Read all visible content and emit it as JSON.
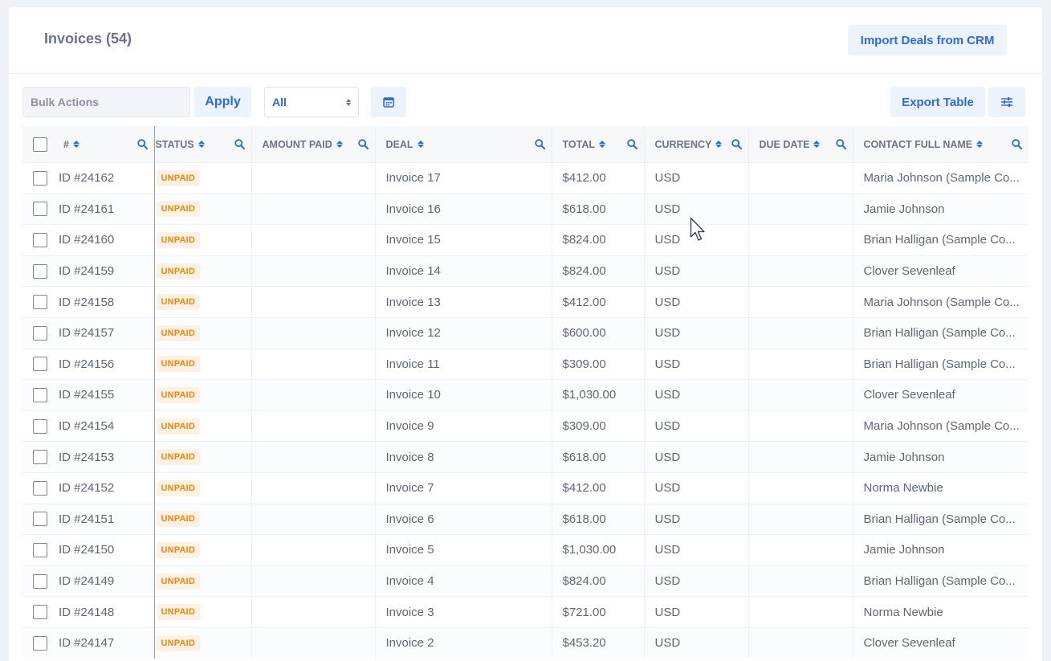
{
  "header": {
    "title": "Invoices (54)",
    "import_label": "Import Deals from CRM"
  },
  "toolbar": {
    "bulk_actions_label": "Bulk Actions",
    "apply_label": "Apply",
    "filter_value": "All",
    "export_label": "Export Table"
  },
  "table": {
    "columns": [
      "#",
      "STATUS",
      "AMOUNT PAID",
      "DEAL",
      "TOTAL",
      "CURRENCY",
      "DUE DATE",
      "CONTACT FULL NAME"
    ],
    "rows": [
      {
        "id": "ID #24162",
        "status": "UNPAID",
        "amount_paid": "",
        "deal": "Invoice 17",
        "total": "$412.00",
        "currency": "USD",
        "due_date": "",
        "contact": "Maria Johnson (Sample Co..."
      },
      {
        "id": "ID #24161",
        "status": "UNPAID",
        "amount_paid": "",
        "deal": "Invoice 16",
        "total": "$618.00",
        "currency": "USD",
        "due_date": "",
        "contact": "Jamie Johnson"
      },
      {
        "id": "ID #24160",
        "status": "UNPAID",
        "amount_paid": "",
        "deal": "Invoice 15",
        "total": "$824.00",
        "currency": "USD",
        "due_date": "",
        "contact": "Brian Halligan (Sample Co..."
      },
      {
        "id": "ID #24159",
        "status": "UNPAID",
        "amount_paid": "",
        "deal": "Invoice 14",
        "total": "$824.00",
        "currency": "USD",
        "due_date": "",
        "contact": "Clover Sevenleaf"
      },
      {
        "id": "ID #24158",
        "status": "UNPAID",
        "amount_paid": "",
        "deal": "Invoice 13",
        "total": "$412.00",
        "currency": "USD",
        "due_date": "",
        "contact": "Maria Johnson (Sample Co..."
      },
      {
        "id": "ID #24157",
        "status": "UNPAID",
        "amount_paid": "",
        "deal": "Invoice 12",
        "total": "$600.00",
        "currency": "USD",
        "due_date": "",
        "contact": "Brian Halligan (Sample Co..."
      },
      {
        "id": "ID #24156",
        "status": "UNPAID",
        "amount_paid": "",
        "deal": "Invoice 11",
        "total": "$309.00",
        "currency": "USD",
        "due_date": "",
        "contact": "Brian Halligan (Sample Co..."
      },
      {
        "id": "ID #24155",
        "status": "UNPAID",
        "amount_paid": "",
        "deal": "Invoice 10",
        "total": "$1,030.00",
        "currency": "USD",
        "due_date": "",
        "contact": "Clover Sevenleaf"
      },
      {
        "id": "ID #24154",
        "status": "UNPAID",
        "amount_paid": "",
        "deal": "Invoice 9",
        "total": "$309.00",
        "currency": "USD",
        "due_date": "",
        "contact": "Maria Johnson (Sample Co..."
      },
      {
        "id": "ID #24153",
        "status": "UNPAID",
        "amount_paid": "",
        "deal": "Invoice 8",
        "total": "$618.00",
        "currency": "USD",
        "due_date": "",
        "contact": "Jamie Johnson"
      },
      {
        "id": "ID #24152",
        "status": "UNPAID",
        "amount_paid": "",
        "deal": "Invoice 7",
        "total": "$412.00",
        "currency": "USD",
        "due_date": "",
        "contact": "Norma Newbie"
      },
      {
        "id": "ID #24151",
        "status": "UNPAID",
        "amount_paid": "",
        "deal": "Invoice 6",
        "total": "$618.00",
        "currency": "USD",
        "due_date": "",
        "contact": "Brian Halligan (Sample Co..."
      },
      {
        "id": "ID #24150",
        "status": "UNPAID",
        "amount_paid": "",
        "deal": "Invoice 5",
        "total": "$1,030.00",
        "currency": "USD",
        "due_date": "",
        "contact": "Jamie Johnson"
      },
      {
        "id": "ID #24149",
        "status": "UNPAID",
        "amount_paid": "",
        "deal": "Invoice 4",
        "total": "$824.00",
        "currency": "USD",
        "due_date": "",
        "contact": "Brian Halligan (Sample Co..."
      },
      {
        "id": "ID #24148",
        "status": "UNPAID",
        "amount_paid": "",
        "deal": "Invoice 3",
        "total": "$721.00",
        "currency": "USD",
        "due_date": "",
        "contact": "Norma Newbie"
      },
      {
        "id": "ID #24147",
        "status": "UNPAID",
        "amount_paid": "",
        "deal": "Invoice 2",
        "total": "$453.20",
        "currency": "USD",
        "due_date": "",
        "contact": "Clover Sevenleaf"
      }
    ]
  },
  "icons": {
    "search": "search-icon",
    "calendar": "calendar-icon",
    "settings": "sliders-icon",
    "sort": "sort-icon",
    "cursor": "mouse-pointer-icon"
  },
  "colors": {
    "accent": "#2f6bd8",
    "button_bg": "#edf3fd",
    "status_text": "#f0890f",
    "status_bg": "#fdf1e4",
    "page_bg": "#eef1f6"
  }
}
